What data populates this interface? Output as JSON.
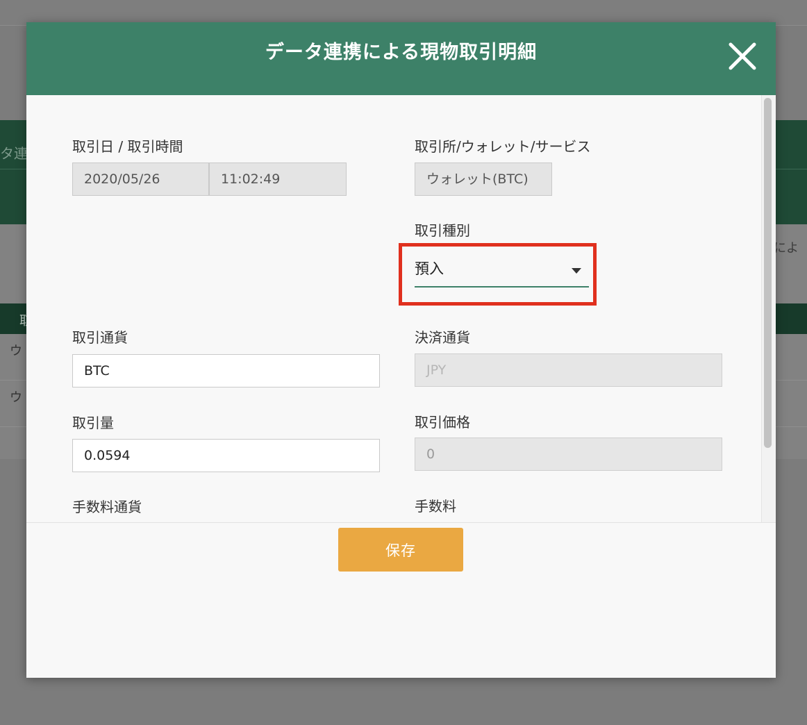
{
  "background": {
    "left_fragment": "タ連携",
    "right_fragment": "によ",
    "table_header_fragment": "取",
    "row_fragments": [
      "ウ",
      "ウ"
    ]
  },
  "modal": {
    "title": "データ連携による現物取引明細",
    "close_icon": "close-icon",
    "colors": {
      "header": "#3d8168",
      "accent_outline": "#e0301e",
      "save": "#eaa842"
    },
    "fields": {
      "datetime": {
        "label": "取引日 / 取引時間",
        "date": "2020/05/26",
        "time": "11:02:49"
      },
      "exchange": {
        "label": "取引所/ウォレット/サービス",
        "value": "ウォレット(BTC)"
      },
      "type": {
        "label": "取引種別",
        "value": "預入"
      },
      "currency": {
        "label": "取引通貨",
        "value": "BTC"
      },
      "settlement": {
        "label": "決済通貨",
        "value": "JPY"
      },
      "amount": {
        "label": "取引量",
        "value": "0.0594"
      },
      "price": {
        "label": "取引価格",
        "value": "0"
      },
      "fee_currency": {
        "label": "手数料通貨"
      },
      "fee": {
        "label": "手数料"
      }
    },
    "save_label": "保存"
  }
}
